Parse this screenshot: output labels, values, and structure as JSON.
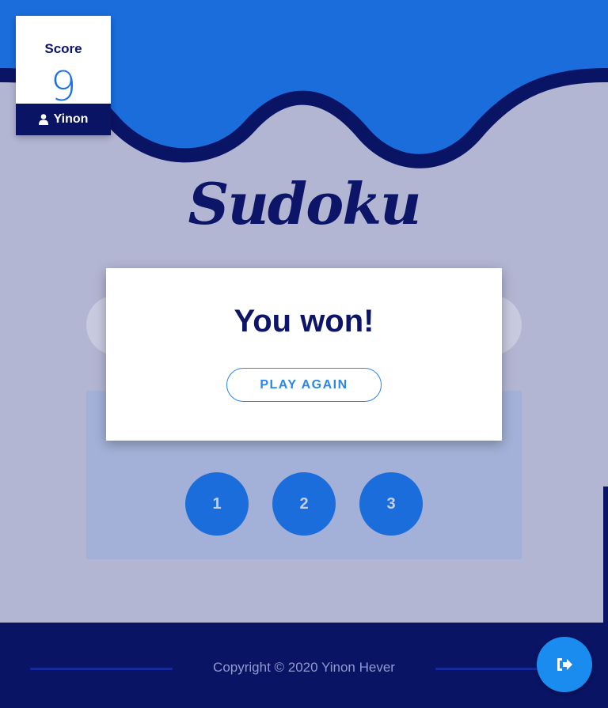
{
  "theme": {
    "background": "#b3b6d3",
    "wave_blue": "#1a6ddb",
    "navy": "#0a1465",
    "accent": "#1a8cf0"
  },
  "score_card": {
    "label": "Score",
    "value": "9",
    "user_icon": "user-icon",
    "user_name": "Yinon"
  },
  "title": "Sudoku",
  "modal": {
    "message": "You won!",
    "button_label": "PLAY AGAIN"
  },
  "number_buttons": [
    "1",
    "2",
    "3"
  ],
  "footer": {
    "copyright": "Copyright © 2020 Yinon Hever",
    "logout_icon": "sign-out-icon"
  }
}
